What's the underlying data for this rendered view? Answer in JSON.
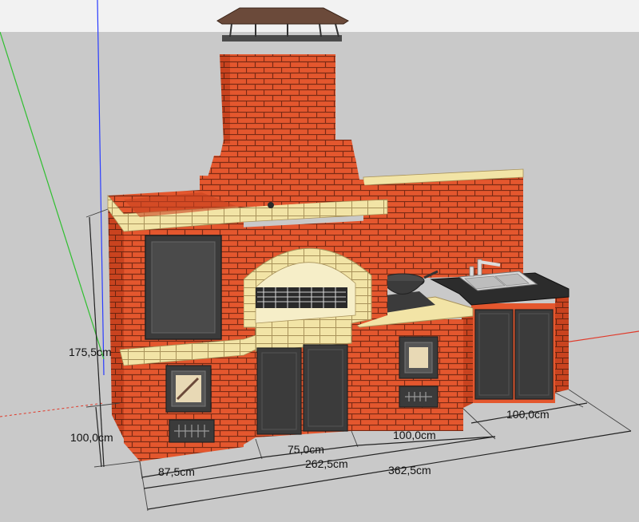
{
  "colors": {
    "brick": "#e4572e",
    "mortar": "#7a2a14",
    "cream": "#f2e4a6",
    "dark": "#3b3b3b",
    "metal": "#5a5a5a",
    "roof": "#6b4a3a",
    "ground": "#c9c9c9",
    "sky": "#f2f2f2",
    "axis_blue": "#2a3cff",
    "axis_green": "#2fbf2f",
    "axis_red": "#e03a2a"
  },
  "dimensions": {
    "height_total": "175,5cm",
    "height_base": "100,0cm",
    "width_left": "87,5cm",
    "width_grill": "75,0cm",
    "width_right": "100,0cm",
    "width_sink": "100,0cm",
    "width_front": "262,5cm",
    "width_total": "362,5cm"
  },
  "icons": {
    "chimney_cap": "chimney-cap-icon",
    "wok": "wok-icon",
    "faucet": "faucet-icon",
    "sink": "sink-icon"
  }
}
